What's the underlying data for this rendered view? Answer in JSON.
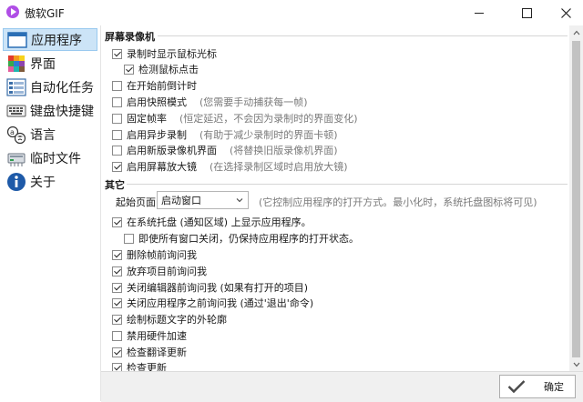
{
  "window": {
    "title": "傲软GIF"
  },
  "sidebar": {
    "items": [
      {
        "label": "应用程序",
        "icon": "app-window-icon",
        "active": true
      },
      {
        "label": "界面",
        "icon": "palette-icon",
        "active": false
      },
      {
        "label": "自动化任务",
        "icon": "task-list-icon",
        "active": false
      },
      {
        "label": "键盘快捷键",
        "icon": "keyboard-icon",
        "active": false
      },
      {
        "label": "语言",
        "icon": "language-icon",
        "active": false
      },
      {
        "label": "临时文件",
        "icon": "temp-files-icon",
        "active": false
      },
      {
        "label": "关于",
        "icon": "info-icon",
        "active": false
      }
    ]
  },
  "recorder": {
    "section_title": "屏幕录像机",
    "options": [
      {
        "label": "录制时显示鼠标光标",
        "hint": "",
        "checked": true
      },
      {
        "label": "检测鼠标点击",
        "hint": "",
        "checked": true
      },
      {
        "label": "在开始前倒计时",
        "hint": "",
        "checked": false
      },
      {
        "label": "启用快照模式",
        "hint": "(您需要手动捕获每一帧)",
        "checked": false
      },
      {
        "label": "固定帧率",
        "hint": "(恒定延迟，不会因为录制时的界面变化)",
        "checked": false
      },
      {
        "label": "启用异步录制",
        "hint": "(有助于减少录制时的界面卡顿)",
        "checked": false
      },
      {
        "label": "启用新版录像机界面",
        "hint": "(将替换旧版录像机界面)",
        "checked": false
      },
      {
        "label": "启用屏幕放大镜",
        "hint": "(在选择录制区域时启用放大镜)",
        "checked": true
      }
    ]
  },
  "other": {
    "section_title": "其它",
    "startup_label": "起始页面:",
    "startup_value": "启动窗口",
    "startup_hint": "(它控制应用程序的打开方式。最小化时，系统托盘图标将可见)",
    "options": [
      {
        "label": "在系统托盘 (通知区域) 上显示应用程序。",
        "checked": true
      },
      {
        "label": "即使所有窗口关闭，仍保持应用程序的打开状态。",
        "checked": false
      },
      {
        "label": "删除帧前询问我",
        "checked": true
      },
      {
        "label": "放弃项目前询问我",
        "checked": true
      },
      {
        "label": "关闭编辑器前询问我 (如果有打开的项目)",
        "checked": true
      },
      {
        "label": "关闭应用程序之前询问我 (通过'退出'命令)",
        "checked": true
      },
      {
        "label": "绘制标题文字的外轮廓",
        "checked": true
      },
      {
        "label": "禁用硬件加速",
        "checked": false
      },
      {
        "label": "检查翻译更新",
        "checked": true
      },
      {
        "label": "检查更新",
        "checked": true
      }
    ]
  },
  "footer": {
    "ok_label": "确定"
  }
}
